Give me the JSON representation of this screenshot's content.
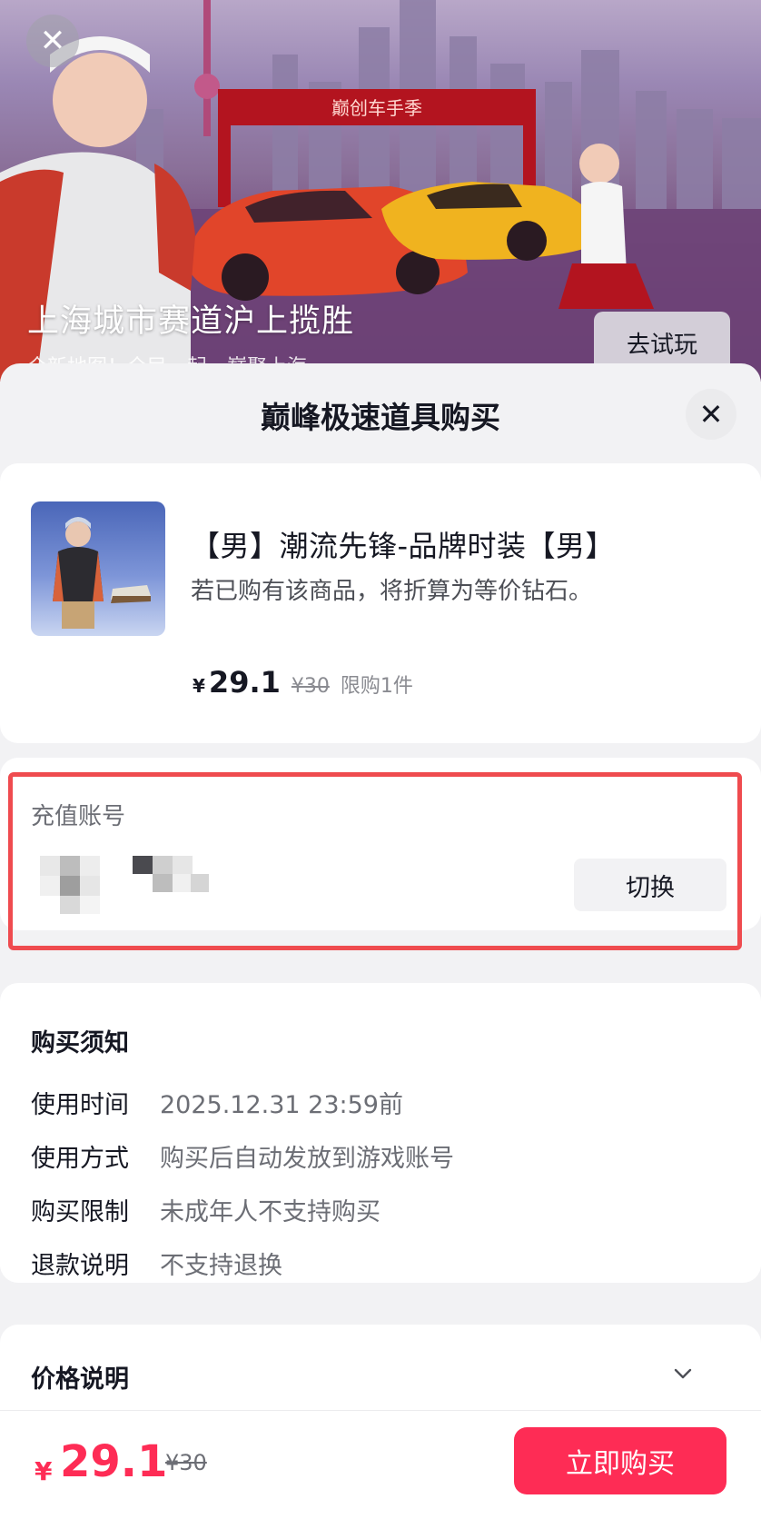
{
  "banner": {
    "close_icon": "close-icon",
    "gate_sign": "巅创车手季",
    "title": "上海城市赛道沪上揽胜",
    "subtitle": "全新地图！全民一起，巅聚上海",
    "try_label": "去试玩"
  },
  "sheet": {
    "title": "巅峰极速道具购买",
    "close_icon": "close-icon"
  },
  "product": {
    "name": "【男】潮流先锋-品牌时装【男】",
    "desc": "若已购有该商品，将折算为等价钻石。",
    "currency": "¥",
    "price": "29.1",
    "original_price": "¥30",
    "limit": "限购1件"
  },
  "account": {
    "label": "充值账号",
    "switch_label": "切换",
    "highlight_color": "#ef4b4f"
  },
  "notice": {
    "title": "购买须知",
    "rows": [
      {
        "key": "使用时间",
        "value": "2025.12.31 23:59前"
      },
      {
        "key": "使用方式",
        "value": "购买后自动发放到游戏账号"
      },
      {
        "key": "购买限制",
        "value": "未成年人不支持购买"
      },
      {
        "key": "退款说明",
        "value": "不支持退换"
      }
    ]
  },
  "price_info": {
    "title": "价格说明",
    "icon": "chevron-down-icon"
  },
  "bottom_bar": {
    "currency": "¥",
    "price": "29.1",
    "original_price": "¥30",
    "buy_label": "立即购买",
    "accent": "#fe2c55"
  }
}
